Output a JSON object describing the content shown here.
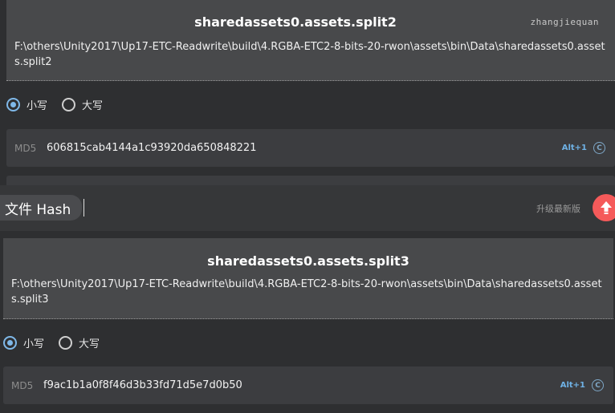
{
  "window1": {
    "username": "zhangjiequan",
    "card": {
      "title": "sharedassets0.assets.split2",
      "path": "F:\\others\\Unity2017\\Up17-ETC-Readwrite\\build\\4.RGBA-ETC2-8-bits-20-rwon\\assets\\bin\\Data\\sharedassets0.assets.split2"
    },
    "radio": {
      "lower_label": "小写",
      "upper_label": "大写",
      "selected": "lower"
    },
    "hash": {
      "algo": "MD5",
      "value": "606815cab4144a1c93920da650848221",
      "shortcut": "Alt+1",
      "copy_glyph": "C"
    }
  },
  "window2": {
    "tab_label": "文件 Hash",
    "update_label": "升级最新版",
    "update_icon": "upload-arrow-icon",
    "card": {
      "title": "sharedassets0.assets.split3",
      "path": "F:\\others\\Unity2017\\Up17-ETC-Readwrite\\build\\4.RGBA-ETC2-8-bits-20-rwon\\assets\\bin\\Data\\sharedassets0.assets.split3"
    },
    "radio": {
      "lower_label": "小写",
      "upper_label": "大写",
      "selected": "lower"
    },
    "hash": {
      "algo": "MD5",
      "value": "f9ac1b1a0f8f46d3b33fd71d5e7d0b50",
      "shortcut": "Alt+1",
      "copy_glyph": "C"
    }
  },
  "colors": {
    "accent": "#7fb8e8",
    "update_button": "#f55a5a",
    "background": "#2e2f31",
    "card": "#48494b"
  }
}
